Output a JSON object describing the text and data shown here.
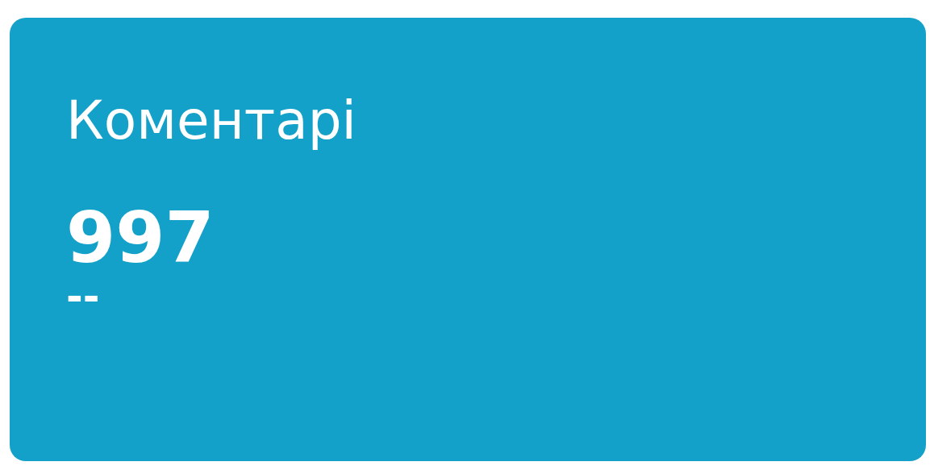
{
  "card": {
    "title": "Коментарі",
    "value": "997",
    "change": "--"
  }
}
